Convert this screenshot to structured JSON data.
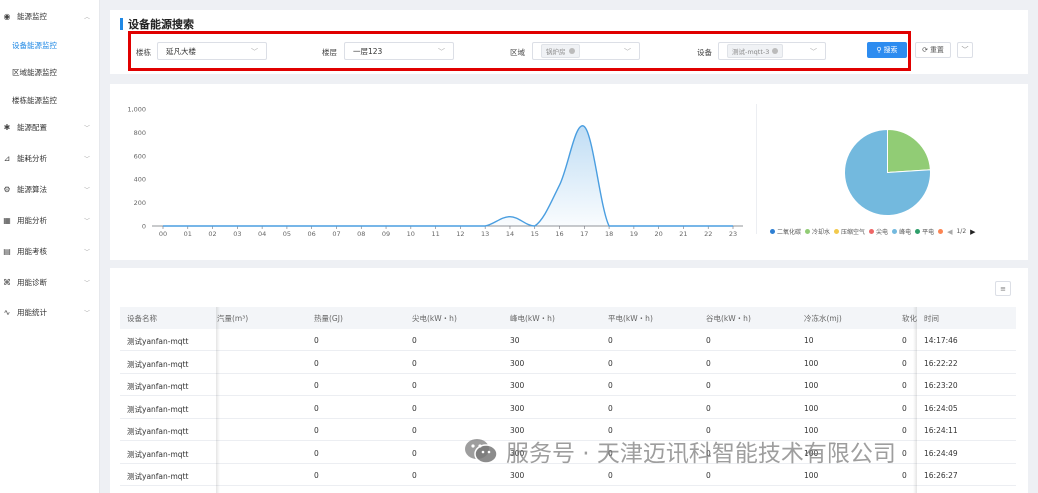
{
  "sidebar": {
    "items": [
      {
        "label": "能源监控",
        "icon": "eye-icon",
        "top": 5,
        "expanded": true
      },
      {
        "label": "能源配置",
        "icon": "network-icon",
        "top": 116
      },
      {
        "label": "能耗分析",
        "icon": "chart-icon",
        "top": 147
      },
      {
        "label": "能源算法",
        "icon": "algorithm-icon",
        "top": 178
      },
      {
        "label": "用能分析",
        "icon": "analysis-icon",
        "top": 209
      },
      {
        "label": "用能考核",
        "icon": "assessment-icon",
        "top": 240
      },
      {
        "label": "用能诊断",
        "icon": "diagnosis-icon",
        "top": 271
      },
      {
        "label": "用能统计",
        "icon": "statistics-icon",
        "top": 301
      }
    ],
    "sub_items": [
      {
        "label": "设备能源监控",
        "active": true
      },
      {
        "label": "区域能源监控",
        "active": false
      },
      {
        "label": "楼栋能源监控",
        "active": false
      }
    ]
  },
  "page": {
    "title": "设备能源搜索"
  },
  "filters": {
    "building_label": "楼栋",
    "building_value": "延凡大楼",
    "floor_label": "楼层",
    "floor_value": "一层123",
    "area_label": "区域",
    "area_tag": "锅炉房",
    "device_label": "设备",
    "device_tag": "测试-mqtt-3",
    "search_button": "搜索",
    "reset_button": "重置"
  },
  "chart_data": [
    {
      "type": "area",
      "x": [
        "00",
        "01",
        "02",
        "03",
        "04",
        "05",
        "06",
        "07",
        "08",
        "09",
        "10",
        "11",
        "12",
        "13",
        "14",
        "15",
        "16",
        "17",
        "18",
        "19",
        "20",
        "21",
        "22",
        "23"
      ],
      "series": [
        {
          "values": [
            0,
            0,
            0,
            0,
            0,
            0,
            0,
            0,
            0,
            0,
            0,
            0,
            0,
            0,
            80,
            0,
            350,
            850,
            0,
            0,
            0,
            0,
            0,
            0
          ]
        }
      ],
      "ylim": [
        0,
        1000
      ],
      "yticks": [
        "0",
        "200",
        "400",
        "600",
        "800",
        "1,000"
      ],
      "color": "#4a9ee0"
    },
    {
      "type": "pie",
      "slices": [
        {
          "name": "二氧化碳",
          "value": 0,
          "color": "#2d7fd3"
        },
        {
          "name": "冷却水",
          "value": 24,
          "color": "#91cc75"
        },
        {
          "name": "压缩空气",
          "value": 0,
          "color": "#f2c94c"
        },
        {
          "name": "尖电",
          "value": 0,
          "color": "#ee6666"
        },
        {
          "name": "峰电",
          "value": 76,
          "color": "#73b9de"
        },
        {
          "name": "平电",
          "value": 0,
          "color": "#2e9e6a"
        }
      ],
      "legend_page": "1/2"
    }
  ],
  "table": {
    "columns": [
      "设备名称",
      "汽量(m³)",
      "热量(GJ)",
      "尖电(kW・h)",
      "峰电(kW・h)",
      "平电(kW・h)",
      "谷电(kW・h)",
      "冷冻水(mj)",
      "软化",
      "时间"
    ],
    "rows": [
      [
        "测试yanfan-mqtt",
        "0",
        "0",
        "30",
        "0",
        "0",
        "10",
        "0",
        "14:17:46"
      ],
      [
        "测试yanfan-mqtt",
        "0",
        "0",
        "300",
        "0",
        "0",
        "100",
        "0",
        "16:22:22"
      ],
      [
        "测试yanfan-mqtt",
        "0",
        "0",
        "300",
        "0",
        "0",
        "100",
        "0",
        "16:23:20"
      ],
      [
        "测试yanfan-mqtt",
        "0",
        "0",
        "300",
        "0",
        "0",
        "100",
        "0",
        "16:24:05"
      ],
      [
        "测试yanfan-mqtt",
        "0",
        "0",
        "300",
        "0",
        "0",
        "100",
        "0",
        "16:24:11"
      ],
      [
        "测试yanfan-mqtt",
        "0",
        "0",
        "300",
        "0",
        "0",
        "100",
        "0",
        "16:24:49"
      ],
      [
        "测试yanfan-mqtt",
        "0",
        "0",
        "300",
        "0",
        "0",
        "100",
        "0",
        "16:26:27"
      ]
    ]
  },
  "watermark": "服务号 · 天津迈讯科智能技术有限公司"
}
